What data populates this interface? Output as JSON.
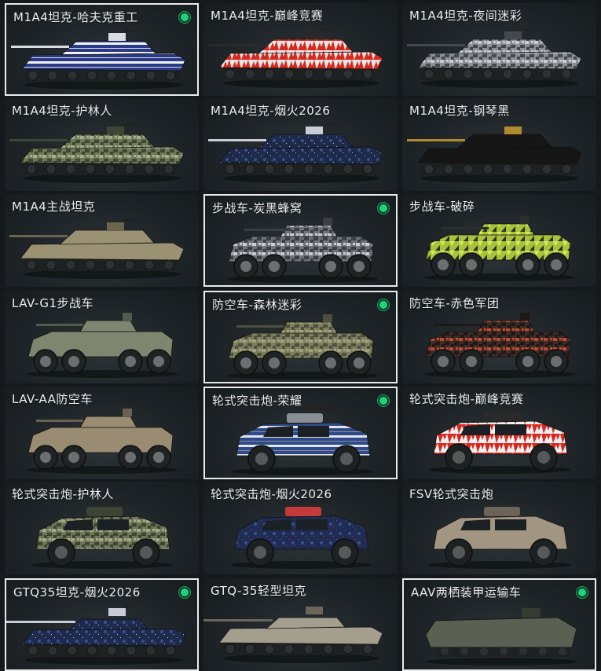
{
  "colors": {
    "selected_border": "#e9eceb",
    "status_dot": "#1fd37e",
    "background": "#16191b"
  },
  "items": [
    {
      "label": "M1A4坦克-哈夫克重工",
      "kind": "tank",
      "selected": true,
      "status": true,
      "scheme": {
        "base": "#2a3a86",
        "accent": "#f2f4f6",
        "accent2": "#d9dde2",
        "pattern": "stripe"
      }
    },
    {
      "label": "M1A4坦克-巅峰竞赛",
      "kind": "tank",
      "selected": false,
      "status": false,
      "scheme": {
        "base": "#e8e8e8",
        "accent": "#d8281e",
        "accent2": "#2a2a2a",
        "pattern": "flame"
      }
    },
    {
      "label": "M1A4坦克-夜间迷彩",
      "kind": "tank",
      "selected": false,
      "status": false,
      "scheme": {
        "base": "#8b8f94",
        "accent": "#c8ccd0",
        "accent2": "#45494e",
        "pattern": "digital"
      }
    },
    {
      "label": "M1A4坦克-护林人",
      "kind": "tank",
      "selected": false,
      "status": false,
      "scheme": {
        "base": "#6f7a58",
        "accent": "#a7ae8e",
        "accent2": "#3e4634",
        "pattern": "digital"
      }
    },
    {
      "label": "M1A4坦克-烟火2026",
      "kind": "tank",
      "selected": false,
      "status": false,
      "scheme": {
        "base": "#1e2a4a",
        "accent": "#3a4f8a",
        "accent2": "#c8ccd8",
        "pattern": "firework"
      }
    },
    {
      "label": "M1A4坦克-钢琴黑",
      "kind": "tank",
      "selected": false,
      "status": false,
      "scheme": {
        "base": "#161616",
        "accent": "#2b2b2b",
        "accent2": "#b08a2c",
        "pattern": "plain"
      }
    },
    {
      "label": "M1A4主战坦克",
      "kind": "tank",
      "selected": false,
      "status": false,
      "scheme": {
        "base": "#9a9272",
        "accent": "#b8b092",
        "accent2": "#6b6450",
        "pattern": "plain"
      }
    },
    {
      "label": "步战车-炭黑蜂窝",
      "kind": "ifv",
      "selected": true,
      "status": true,
      "scheme": {
        "base": "#6e7378",
        "accent": "#c9cdd1",
        "accent2": "#3b3f44",
        "pattern": "digital"
      }
    },
    {
      "label": "步战车-破碎",
      "kind": "ifv",
      "selected": false,
      "status": false,
      "scheme": {
        "base": "#a8c23a",
        "accent": "#d8e85a",
        "accent2": "#2a2f2a",
        "pattern": "shatter"
      }
    },
    {
      "label": "LAV-G1步战车",
      "kind": "lav",
      "selected": false,
      "status": false,
      "scheme": {
        "base": "#7f8670",
        "accent": "#9ba08a",
        "accent2": "#555b4a",
        "pattern": "plain"
      }
    },
    {
      "label": "防空车-森林迷彩",
      "kind": "lav",
      "selected": true,
      "status": true,
      "scheme": {
        "base": "#7e7f5f",
        "accent": "#a4a27c",
        "accent2": "#4d503c",
        "pattern": "digital"
      }
    },
    {
      "label": "防空车-赤色军团",
      "kind": "lav",
      "selected": false,
      "status": false,
      "scheme": {
        "base": "#3c2c28",
        "accent": "#c14a2e",
        "accent2": "#1f1816",
        "pattern": "digital"
      }
    },
    {
      "label": "LAV-AA防空车",
      "kind": "lav",
      "selected": false,
      "status": false,
      "scheme": {
        "base": "#9a8c72",
        "accent": "#b5a88c",
        "accent2": "#6b6150",
        "pattern": "plain"
      }
    },
    {
      "label": "轮式突击炮-荣耀",
      "kind": "mrap",
      "selected": true,
      "status": true,
      "scheme": {
        "base": "#2e4a8a",
        "accent": "#e2e4e6",
        "accent2": "#8a8f95",
        "pattern": "stripe"
      }
    },
    {
      "label": "轮式突击炮-巅峰竞赛",
      "kind": "mrap",
      "selected": false,
      "status": false,
      "scheme": {
        "base": "#d8281e",
        "accent": "#f2f2f2",
        "accent2": "#2a2a2a",
        "pattern": "flame"
      }
    },
    {
      "label": "轮式突击炮-护林人",
      "kind": "mrap",
      "selected": false,
      "status": false,
      "scheme": {
        "base": "#6e7656",
        "accent": "#a6ab8c",
        "accent2": "#3e4534",
        "pattern": "digital"
      }
    },
    {
      "label": "轮式突击炮-烟火2026",
      "kind": "mrap",
      "selected": false,
      "status": false,
      "scheme": {
        "base": "#1f2d55",
        "accent": "#39508c",
        "accent2": "#c43a3a",
        "pattern": "firework"
      }
    },
    {
      "label": "FSV轮式突击炮",
      "kind": "mrap",
      "selected": false,
      "status": false,
      "scheme": {
        "base": "#a29682",
        "accent": "#bcb29e",
        "accent2": "#6c6456",
        "pattern": "plain"
      }
    },
    {
      "label": "GTQ35坦克-烟火2026",
      "kind": "light",
      "selected": true,
      "status": true,
      "scheme": {
        "base": "#1f2b4e",
        "accent": "#3a4f8a",
        "accent2": "#c8ccd8",
        "pattern": "firework"
      }
    },
    {
      "label": "GTQ-35轻型坦克",
      "kind": "light",
      "selected": false,
      "status": false,
      "scheme": {
        "base": "#a49e8e",
        "accent": "#c4bfb0",
        "accent2": "#6b665a",
        "pattern": "plain"
      }
    },
    {
      "label": "AAV两栖装甲运输车",
      "kind": "aav",
      "selected": true,
      "status": true,
      "scheme": {
        "base": "#5a6152",
        "accent": "#7b8270",
        "accent2": "#363b30",
        "pattern": "plain"
      }
    }
  ]
}
